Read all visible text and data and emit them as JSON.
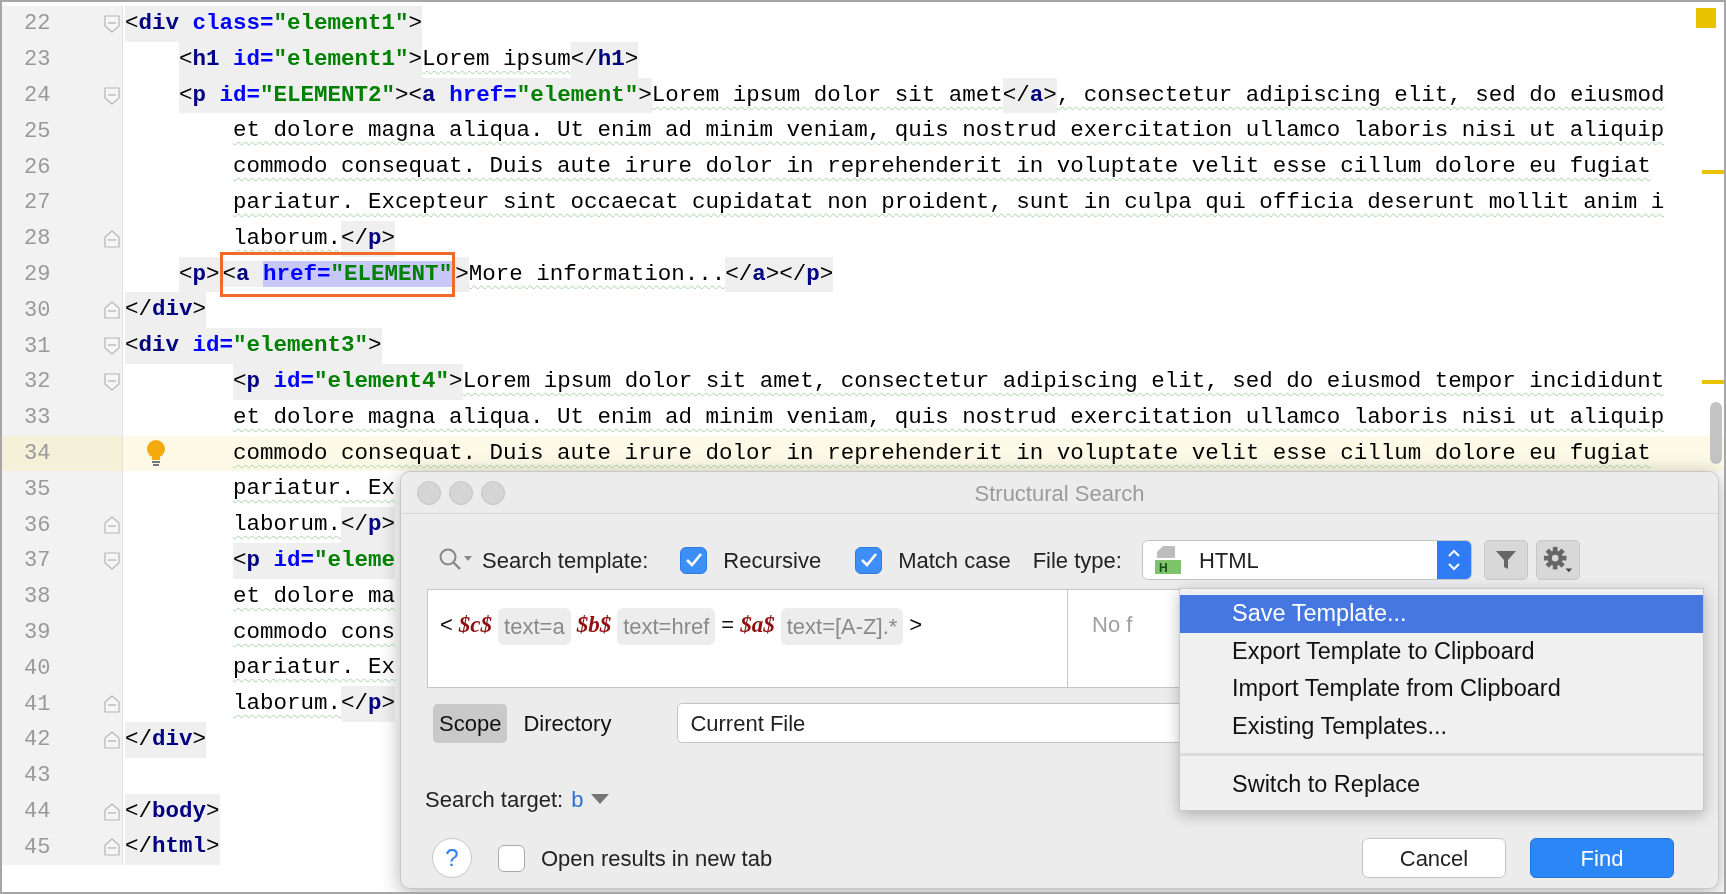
{
  "editor": {
    "lines": [
      {
        "number": "22",
        "fold": {
          "kind": "start"
        },
        "current": false,
        "segments": [
          {
            "kind": "bracket",
            "text": "<"
          },
          {
            "kind": "tag",
            "text": "div"
          },
          {
            "kind": "attr",
            "text": " class="
          },
          {
            "kind": "value",
            "text": "\"element1\""
          },
          {
            "kind": "bracket",
            "text": ">"
          }
        ]
      },
      {
        "number": "23",
        "current": false,
        "segments": [
          {
            "kind": "bracket",
            "text": "    <"
          },
          {
            "kind": "tag",
            "text": "h1"
          },
          {
            "kind": "attr",
            "text": " id="
          },
          {
            "kind": "value",
            "text": "\"element1\""
          },
          {
            "kind": "bracket",
            "text": ">"
          },
          {
            "kind": "text",
            "text": "Lorem ipsum"
          },
          {
            "kind": "bracket",
            "text": "</"
          },
          {
            "kind": "tag",
            "text": "h1"
          },
          {
            "kind": "bracket",
            "text": ">"
          }
        ]
      },
      {
        "number": "24",
        "fold": {
          "kind": "start"
        },
        "current": false,
        "segments": [
          {
            "kind": "bracket",
            "text": "    <"
          },
          {
            "kind": "tag",
            "text": "p"
          },
          {
            "kind": "attr",
            "text": " id="
          },
          {
            "kind": "value",
            "text": "\"ELEMENT2\""
          },
          {
            "kind": "bracket",
            "text": "><"
          },
          {
            "kind": "tag",
            "text": "a"
          },
          {
            "kind": "attr",
            "text": " href="
          },
          {
            "kind": "value",
            "text": "\"element\""
          },
          {
            "kind": "bracket",
            "text": ">"
          },
          {
            "kind": "text",
            "text": "Lorem ipsum dolor sit amet"
          },
          {
            "kind": "bracket",
            "text": "</"
          },
          {
            "kind": "tag",
            "text": "a"
          },
          {
            "kind": "bracket",
            "text": ">"
          },
          {
            "kind": "text",
            "text": ", consectetur adipiscing elit, sed do eiusmod"
          }
        ]
      },
      {
        "number": "25",
        "current": false,
        "segments": [
          {
            "kind": "text",
            "text": "        et dolore magna aliqua. Ut enim ad minim veniam, quis nostrud exercitation ullamco laboris nisi ut aliquip"
          }
        ]
      },
      {
        "number": "26",
        "current": false,
        "segments": [
          {
            "kind": "text",
            "text": "        commodo consequat. Duis aute irure dolor in reprehenderit in voluptate velit esse cillum dolore eu fugiat"
          }
        ]
      },
      {
        "number": "27",
        "current": false,
        "segments": [
          {
            "kind": "text",
            "text": "        pariatur. Excepteur sint occaecat cupidatat non proident, sunt in culpa qui officia deserunt mollit anim i"
          }
        ]
      },
      {
        "number": "28",
        "fold": {
          "kind": "end"
        },
        "current": false,
        "segments": [
          {
            "kind": "text",
            "text": "        laborum."
          },
          {
            "kind": "bracket",
            "text": "</"
          },
          {
            "kind": "tag",
            "text": "p"
          },
          {
            "kind": "bracket",
            "text": ">"
          }
        ]
      },
      {
        "number": "29",
        "current": false,
        "segments": [
          {
            "kind": "bracket",
            "text": "    <"
          },
          {
            "kind": "tag",
            "text": "p"
          },
          {
            "kind": "bracket",
            "text": ">"
          },
          {
            "kind": "bracket",
            "text": "<",
            "boxed": true
          },
          {
            "kind": "tag",
            "text": "a ",
            "boxed": true
          },
          {
            "kind": "attr",
            "text": "href=",
            "boxed": true,
            "selected": true
          },
          {
            "kind": "value",
            "text": "\"ELEMENT\"",
            "boxed": true,
            "selected": true
          },
          {
            "kind": "bracket",
            "text": ">"
          },
          {
            "kind": "text",
            "text": "More information..."
          },
          {
            "kind": "bracket",
            "text": "</"
          },
          {
            "kind": "tag",
            "text": "a"
          },
          {
            "kind": "bracket",
            "text": "></"
          },
          {
            "kind": "tag",
            "text": "p"
          },
          {
            "kind": "bracket",
            "text": ">"
          }
        ]
      },
      {
        "number": "30",
        "fold": {
          "kind": "end"
        },
        "current": false,
        "segments": [
          {
            "kind": "bracket",
            "text": "</"
          },
          {
            "kind": "tag",
            "text": "div"
          },
          {
            "kind": "bracket",
            "text": ">"
          }
        ]
      },
      {
        "number": "31",
        "fold": {
          "kind": "start"
        },
        "current": false,
        "segments": [
          {
            "kind": "bracket",
            "text": "<"
          },
          {
            "kind": "tag",
            "text": "div"
          },
          {
            "kind": "attr",
            "text": " id="
          },
          {
            "kind": "value",
            "text": "\"element3\""
          },
          {
            "kind": "bracket",
            "text": ">"
          }
        ]
      },
      {
        "number": "32",
        "fold": {
          "kind": "start"
        },
        "current": false,
        "segments": [
          {
            "kind": "bracket",
            "text": "        <"
          },
          {
            "kind": "tag",
            "text": "p"
          },
          {
            "kind": "attr",
            "text": " id="
          },
          {
            "kind": "value",
            "text": "\"element4\""
          },
          {
            "kind": "bracket",
            "text": ">"
          },
          {
            "kind": "text",
            "text": "Lorem ipsum dolor sit amet, consectetur adipiscing elit, sed do eiusmod tempor incididunt"
          }
        ]
      },
      {
        "number": "33",
        "current": false,
        "segments": [
          {
            "kind": "text",
            "text": "        et dolore magna aliqua. Ut enim ad minim veniam, quis nostrud exercitation ullamco laboris nisi ut aliquip"
          }
        ]
      },
      {
        "number": "34",
        "current": true,
        "bulb": true,
        "segments": [
          {
            "kind": "text",
            "text": "        commodo consequat. Duis aute irure dolor in reprehenderit in voluptate velit esse cillum dolore eu fugiat"
          }
        ]
      },
      {
        "number": "35",
        "current": false,
        "segments": [
          {
            "kind": "text",
            "text": "        pariatur. Ex"
          }
        ]
      },
      {
        "number": "36",
        "fold": {
          "kind": "end"
        },
        "current": false,
        "segments": [
          {
            "kind": "text",
            "text": "        laborum."
          },
          {
            "kind": "bracket",
            "text": "</"
          },
          {
            "kind": "tag",
            "text": "p"
          },
          {
            "kind": "bracket",
            "text": ">"
          }
        ]
      },
      {
        "number": "37",
        "fold": {
          "kind": "start"
        },
        "current": false,
        "segments": [
          {
            "kind": "bracket",
            "text": "        <"
          },
          {
            "kind": "tag",
            "text": "p"
          },
          {
            "kind": "attr",
            "text": " id="
          },
          {
            "kind": "value",
            "text": "\"eleme"
          }
        ]
      },
      {
        "number": "38",
        "current": false,
        "segments": [
          {
            "kind": "text",
            "text": "        et dolore ma"
          }
        ]
      },
      {
        "number": "39",
        "current": false,
        "segments": [
          {
            "kind": "text",
            "text": "        commodo cons"
          }
        ]
      },
      {
        "number": "40",
        "current": false,
        "segments": [
          {
            "kind": "text",
            "text": "        pariatur. Ex"
          }
        ]
      },
      {
        "number": "41",
        "fold": {
          "kind": "end"
        },
        "current": false,
        "segments": [
          {
            "kind": "text",
            "text": "        laborum."
          },
          {
            "kind": "bracket",
            "text": "</"
          },
          {
            "kind": "tag",
            "text": "p"
          },
          {
            "kind": "bracket",
            "text": ">"
          }
        ]
      },
      {
        "number": "42",
        "fold": {
          "kind": "end"
        },
        "current": false,
        "segments": [
          {
            "kind": "bracket",
            "text": "</"
          },
          {
            "kind": "tag",
            "text": "div"
          },
          {
            "kind": "bracket",
            "text": ">"
          }
        ]
      },
      {
        "number": "43",
        "current": false
      },
      {
        "number": "44",
        "fold": {
          "kind": "end"
        },
        "current": false,
        "segments": [
          {
            "kind": "bracket",
            "text": "</"
          },
          {
            "kind": "tag",
            "text": "body"
          },
          {
            "kind": "bracket",
            "text": ">"
          }
        ]
      },
      {
        "number": "45",
        "fold": {
          "kind": "end"
        },
        "current": false,
        "segments": [
          {
            "kind": "bracket",
            "text": "</"
          },
          {
            "kind": "tag",
            "text": "html"
          },
          {
            "kind": "bracket",
            "text": ">"
          }
        ]
      }
    ]
  },
  "dialog": {
    "title": "Structural Search",
    "search_label": "Search template:",
    "options": [
      {
        "label": "Recursive",
        "checked": true
      },
      {
        "label": "Match case",
        "checked": true
      }
    ],
    "file_type_label": "File type:",
    "file_type_icon_text": "H",
    "file_type": "HTML",
    "template": [
      {
        "kind": "punct",
        "text": "<"
      },
      {
        "kind": "var",
        "text": "$c$"
      },
      {
        "kind": "constraint",
        "text": "text=a"
      },
      {
        "kind": "var",
        "text": "$b$"
      },
      {
        "kind": "constraint",
        "text": "text=href"
      },
      {
        "kind": "punct",
        "text": "="
      },
      {
        "kind": "var",
        "text": "$a$"
      },
      {
        "kind": "constraint",
        "text": "text=[A-Z].*"
      },
      {
        "kind": "punct",
        "text": ">"
      }
    ],
    "preview": "No f",
    "scope_tabs": [
      {
        "label": "Scope",
        "selected": true
      },
      {
        "label": "Directory",
        "selected": false
      }
    ],
    "scope_value": "Current File",
    "target_label": "Search target:",
    "target_value": "b",
    "help": "?",
    "new_tab_option": {
      "label": "Open results in new tab",
      "checked": false
    },
    "buttons": [
      {
        "label": "Cancel",
        "kind": "default"
      },
      {
        "label": "Find",
        "kind": "primary"
      }
    ],
    "menu": {
      "groups": [
        {
          "items": [
            {
              "label": "Save Template...",
              "selected": true
            },
            {
              "label": "Export Template to Clipboard",
              "selected": false
            },
            {
              "label": "Import Template from Clipboard",
              "selected": false
            },
            {
              "label": "Existing Templates...",
              "selected": false
            }
          ]
        },
        {
          "items": [
            {
              "label": "Switch to Replace",
              "selected": false
            }
          ]
        }
      ]
    }
  }
}
